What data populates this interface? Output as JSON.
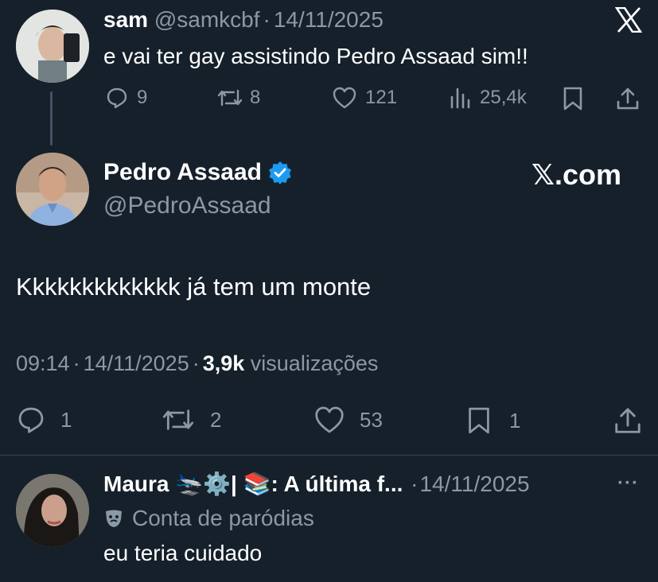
{
  "reply_tweet": {
    "name": "sam",
    "handle": "@samkcbf",
    "date": "14/11/2025",
    "separator": "·",
    "text": "e vai ter gay assistindo Pedro Assaad sim!!",
    "replies": "9",
    "reposts": "8",
    "likes": "121",
    "views": "25,4k"
  },
  "main_tweet": {
    "name": "Pedro Assaad",
    "handle": "@PedroAssaad",
    "verified": true,
    "watermark": "𝕏.com",
    "text": "Kkkkkkkkkkkkk já tem um monte",
    "time": "09:14",
    "date": "14/11/2025",
    "separator": "·",
    "views_count": "3,9k",
    "views_label": "visualizações",
    "replies": "1",
    "reposts": "2",
    "likes": "53",
    "bookmarks": "1"
  },
  "bottom_tweet": {
    "name": "Maura 🛬⚙️| 📚: A última f...",
    "date": "14/11/2025",
    "separator": "·",
    "parody_label": "Conta de paródias",
    "text": "eu teria cuidado",
    "more": "···"
  },
  "colors": {
    "background": "#15202b",
    "muted": "#8b98a5",
    "verified": "#1d9bf0",
    "divider": "#38444d"
  }
}
